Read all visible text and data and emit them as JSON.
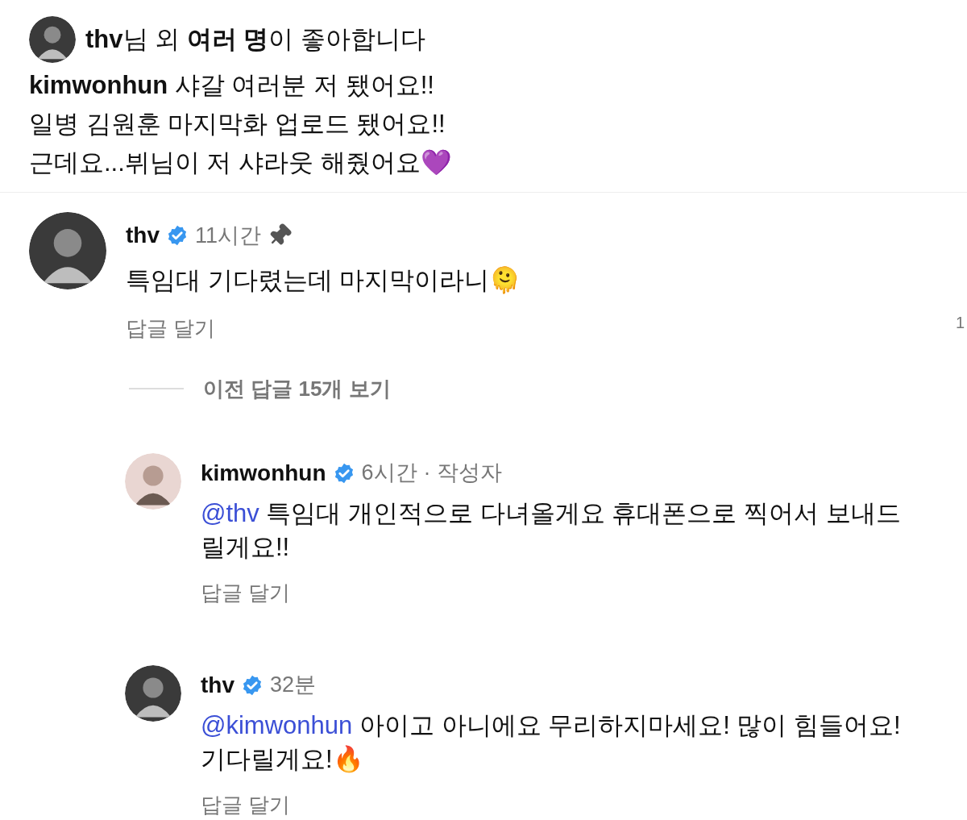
{
  "caption": {
    "likes": "**thv**님 외 **여러 명**이 좋아합니다",
    "author": "kimwonhun",
    "lines": [
      "샤갈 여러분 저 됐어요!!",
      "일병 김원훈 마지막화 업로드 됐어요!!",
      "근데요...뷔님이 저 샤라웃 해줬어요💜"
    ]
  },
  "comment": {
    "author": "thv",
    "verified": true,
    "time": "11시간",
    "pinned": true,
    "text": "특임대 기다렸는데 마지막이라니🫠",
    "reply": "답글 달기",
    "like_count": "1"
  },
  "view_replies": "이전 답글 15개 보기",
  "replies": [
    {
      "author": "kimwonhun",
      "verified": true,
      "time": "6시간",
      "tag": "· 작성자",
      "mention": "@thv",
      "text": "특임대 개인적으로 다녀올게요 휴대폰으로 찍어서 보내드릴게요!!",
      "reply": "답글 달기"
    },
    {
      "author": "thv",
      "verified": true,
      "time": "32분",
      "mention": "@kimwonhun",
      "text": "아이고 아니에요 무리하지마세요! 많이 힘들어요! 기다릴게요!🔥",
      "reply": "답글 달기"
    }
  ]
}
